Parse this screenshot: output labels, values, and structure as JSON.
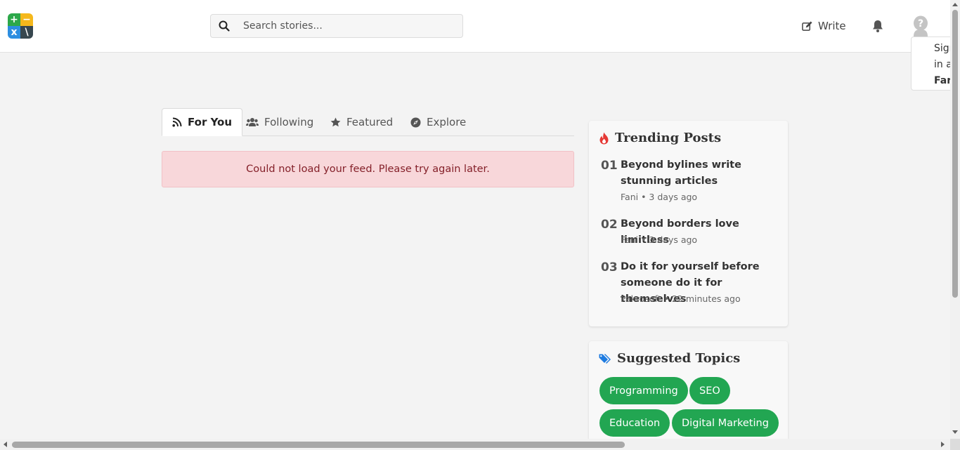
{
  "header": {
    "logo_symbols": [
      "+",
      "−",
      "x",
      "\\"
    ],
    "search_placeholder": "Search stories...",
    "write_label": "Write",
    "avatar_icon": "question-avatar-icon",
    "signin_popup": [
      "Sign",
      "in a",
      "Far"
    ]
  },
  "tabs": [
    {
      "label": "For You",
      "icon": "rss-icon",
      "active": true
    },
    {
      "label": "Following",
      "icon": "users-icon",
      "active": false
    },
    {
      "label": "Featured",
      "icon": "star-icon",
      "active": false
    },
    {
      "label": "Explore",
      "icon": "compass-icon",
      "active": false
    }
  ],
  "feed": {
    "error_message": "Could not load your feed. Please try again later."
  },
  "trending": {
    "title": "Trending Posts",
    "icon": "fire-icon",
    "items": [
      {
        "num": "01",
        "title": "Beyond bylines write stunning articles",
        "meta": "Fani • 3 days ago"
      },
      {
        "num": "02",
        "title": "Beyond borders love limitless",
        "meta": "Fani • 3 days ago"
      },
      {
        "num": "03",
        "title": "Do it for yourself before someone do it for themselves",
        "meta": "Pakrosoft • 22 minutes ago"
      }
    ]
  },
  "topics": {
    "title": "Suggested Topics",
    "icon": "tags-icon",
    "items": [
      "Programming",
      "SEO",
      "Education",
      "Digital Marketing"
    ]
  },
  "colors": {
    "accent_green": "#22a652",
    "alert_bg": "#f8d7da",
    "alert_text": "#842029",
    "fire": "#e53935",
    "tag_blue": "#1e7be0"
  }
}
